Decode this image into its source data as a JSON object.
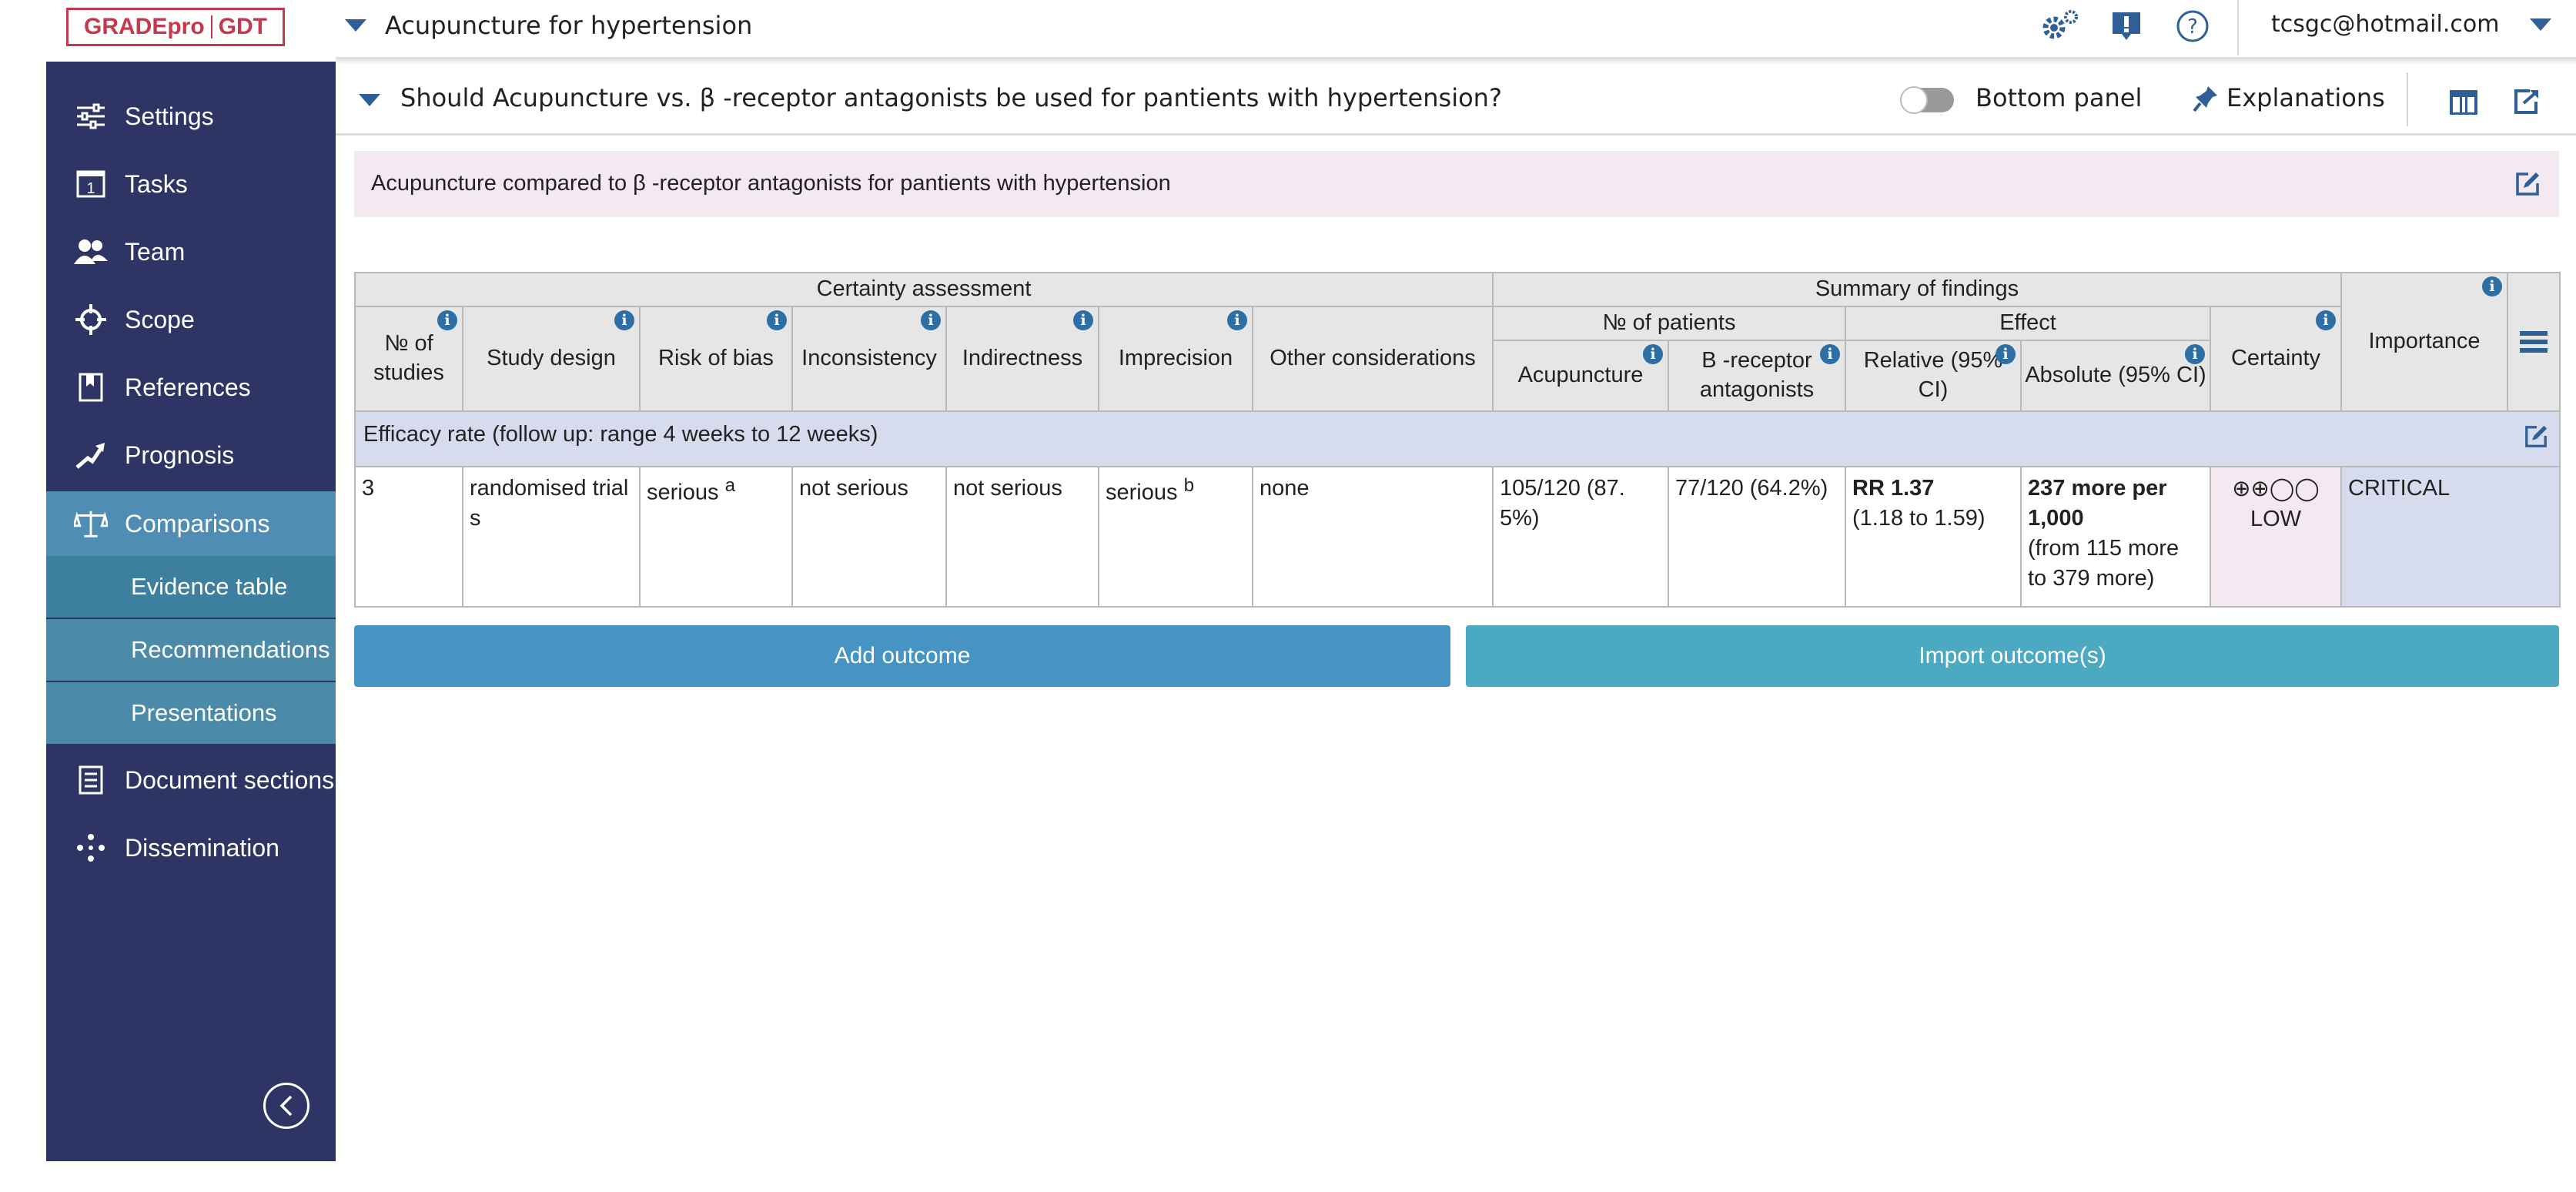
{
  "app": {
    "logo_left": "GRADEpro",
    "logo_right": "GDT",
    "project_name": "Acupuncture for hypertension",
    "user_email": "tcsgc@hotmail.com",
    "icons": [
      "settings-gear-icon",
      "feedback-icon",
      "help-icon"
    ]
  },
  "sidebar": {
    "items": [
      {
        "label": "Settings",
        "icon": "sliders-icon"
      },
      {
        "label": "Tasks",
        "icon": "calendar-icon"
      },
      {
        "label": "Team",
        "icon": "team-icon"
      },
      {
        "label": "Scope",
        "icon": "crosshair-icon"
      },
      {
        "label": "References",
        "icon": "bookmark-icon"
      },
      {
        "label": "Prognosis",
        "icon": "trend-icon"
      },
      {
        "label": "Comparisons",
        "icon": "scales-icon",
        "active": true
      }
    ],
    "subitems": [
      {
        "label": "Evidence table",
        "current": true
      },
      {
        "label": "Recommendations"
      },
      {
        "label": "Presentations"
      }
    ],
    "items_after": [
      {
        "label": "Document sections",
        "icon": "document-icon"
      },
      {
        "label": "Dissemination",
        "icon": "share-icon"
      }
    ]
  },
  "question_bar": {
    "question": "Should Acupuncture vs. β -receptor antagonists be used for pantients with hypertension?",
    "bottom_panel_label": "Bottom panel",
    "bottom_panel_on": false,
    "explanations_label": "Explanations"
  },
  "table_title": "Acupuncture compared to β -receptor antagonists for pantients with hypertension",
  "table": {
    "group_headers": {
      "certainty_assessment": "Certainty assessment",
      "summary_of_findings": "Summary of findings",
      "no_of_patients": "№ of patients",
      "effect": "Effect"
    },
    "columns": {
      "studies": "№ of studies",
      "design": "Study design",
      "risk_of_bias": "Risk of bias",
      "inconsistency": "Inconsistency",
      "indirectness": "Indirectness",
      "imprecision": "Imprecision",
      "other": "Other considerations",
      "intervention": "Acupuncture",
      "comparison": "B -receptor antagonists",
      "relative": "Relative (95% CI)",
      "absolute": "Absolute (95% CI)",
      "certainty": "Certainty",
      "importance": "Importance"
    },
    "outcome": {
      "name": "Efficacy rate (follow up: range 4 weeks to 12 weeks)",
      "studies": "3",
      "design": "randomised trials",
      "risk_of_bias": "serious",
      "risk_of_bias_note": "a",
      "inconsistency": "not serious",
      "indirectness": "not serious",
      "imprecision": "serious",
      "imprecision_note": "b",
      "other": "none",
      "intervention": "105/120 (87.5%)",
      "comparison": "77/120 (64.2%)",
      "relative_main": "RR 1.37",
      "relative_ci": "(1.18 to 1.59)",
      "absolute_main": "237 more per 1,000",
      "absolute_ci": "(from 115 more to 379 more)",
      "certainty_symbols": "⊕⊕◯◯",
      "certainty_label": "LOW",
      "importance": "CRITICAL"
    }
  },
  "buttons": {
    "add_outcome": "Add outcome",
    "import_outcomes": "Import outcome(s)"
  }
}
